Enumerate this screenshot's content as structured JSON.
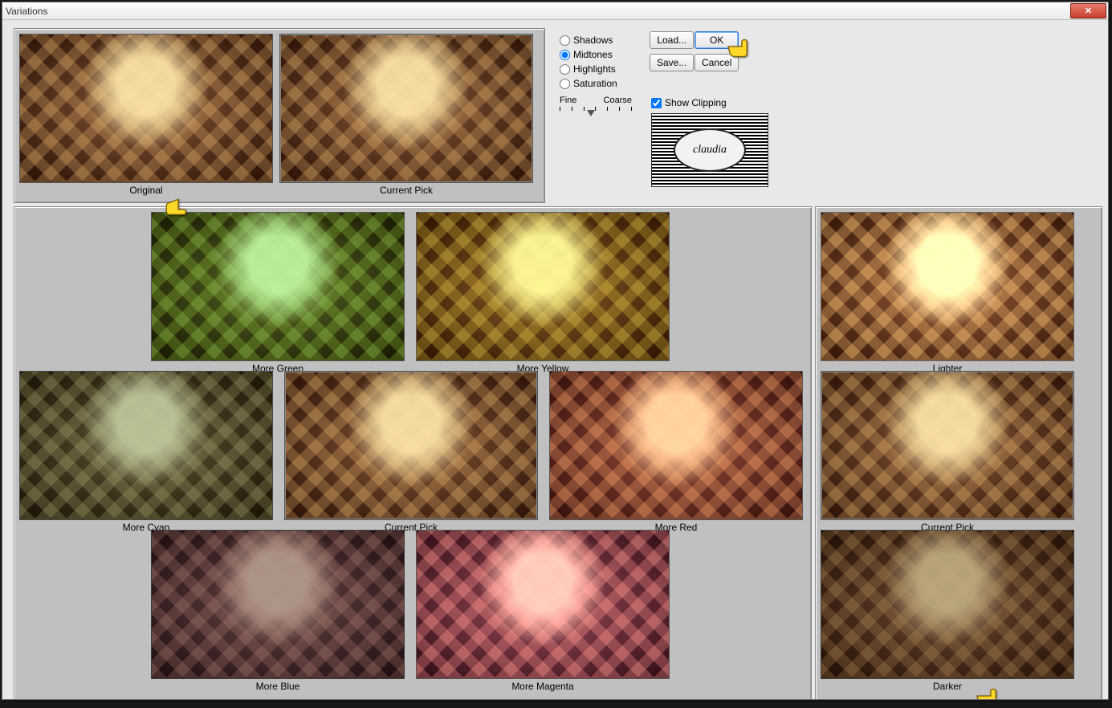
{
  "window": {
    "title": "Variations"
  },
  "buttons": {
    "load": "Load...",
    "save": "Save...",
    "ok": "OK",
    "cancel": "Cancel"
  },
  "tone": {
    "shadows": "Shadows",
    "midtones": "Midtones",
    "highlights": "Highlights",
    "saturation": "Saturation",
    "selected": "midtones"
  },
  "slider": {
    "fine": "Fine",
    "coarse": "Coarse"
  },
  "show_clipping": {
    "label": "Show Clipping",
    "checked": true
  },
  "logo": {
    "text": "claudia"
  },
  "top": {
    "original": "Original",
    "current": "Current Pick"
  },
  "variations": {
    "more_green": "More Green",
    "more_yellow": "More Yellow",
    "more_cyan": "More Cyan",
    "current": "Current Pick",
    "more_red": "More Red",
    "more_blue": "More Blue",
    "more_magenta": "More Magenta"
  },
  "brightness": {
    "lighter": "Lighter",
    "current": "Current Pick",
    "darker": "Darker"
  }
}
